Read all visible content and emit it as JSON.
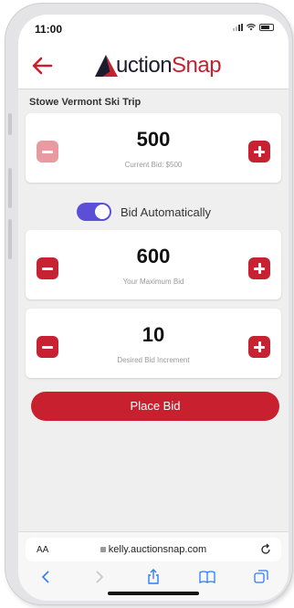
{
  "status": {
    "time": "11:00"
  },
  "app": {
    "logo_part1": "uction",
    "logo_part2": "Snap"
  },
  "auction": {
    "item_title": "Stowe Vermont Ski Trip"
  },
  "current_bid": {
    "value": "500",
    "caption": "Current Bid: $500"
  },
  "auto_bid": {
    "label": "Bid Automatically",
    "enabled": true
  },
  "max_bid": {
    "value": "600",
    "caption": "Your Maximum Bid"
  },
  "increment": {
    "value": "10",
    "caption": "Desired Bid Increment"
  },
  "actions": {
    "place_bid": "Place Bid"
  },
  "browser": {
    "aa_label": "AA",
    "url": "kelly.auctionsnap.com"
  },
  "colors": {
    "brand_red": "#c8202e",
    "toggle_purple": "#5a4fd6",
    "ios_blue": "#2f7cf6"
  },
  "icons": [
    "back-arrow-icon",
    "logo-mark-icon",
    "minus-icon",
    "plus-icon",
    "lock-icon",
    "reload-icon",
    "back-icon",
    "forward-icon",
    "share-icon",
    "bookmarks-icon",
    "tabs-icon"
  ]
}
